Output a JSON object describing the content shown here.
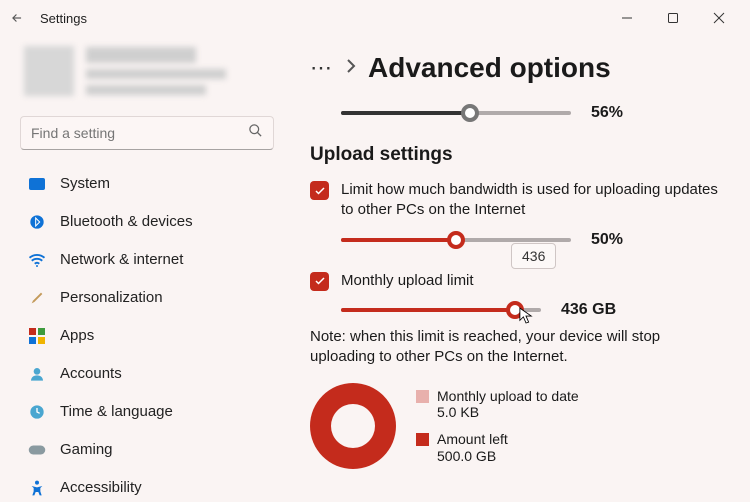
{
  "titlebar": {
    "title": "Settings"
  },
  "search": {
    "placeholder": "Find a setting"
  },
  "nav": [
    {
      "id": "system",
      "label": "System",
      "color": "#0f72d6"
    },
    {
      "id": "bluetooth",
      "label": "Bluetooth & devices",
      "color": "#0f72d6"
    },
    {
      "id": "network",
      "label": "Network & internet",
      "color": "#0f72d6"
    },
    {
      "id": "personalization",
      "label": "Personalization",
      "color": "#c49a5a"
    },
    {
      "id": "apps",
      "label": "Apps",
      "color": "#c42b1c"
    },
    {
      "id": "accounts",
      "label": "Accounts",
      "color": "#4aa6d0"
    },
    {
      "id": "time",
      "label": "Time & language",
      "color": "#4aa6d0"
    },
    {
      "id": "gaming",
      "label": "Gaming",
      "color": "#8a9aa0"
    },
    {
      "id": "accessibility",
      "label": "Accessibility",
      "color": "#0f72d6"
    }
  ],
  "header": {
    "title": "Advanced options"
  },
  "topSlider": {
    "percent": 56,
    "label": "56%"
  },
  "section": {
    "title": "Upload settings"
  },
  "opt1": {
    "text": "Limit how much bandwidth is used for uploading updates to other PCs on the Internet",
    "percent": 50,
    "label": "50%",
    "tooltip": "436"
  },
  "opt2": {
    "text": "Monthly upload limit",
    "percent": 87,
    "label": "436 GB"
  },
  "note": "Note: when this limit is reached, your device will stop uploading to other PCs on the Internet.",
  "legend": {
    "a_label": "Monthly upload to date",
    "a_value": "5.0 KB",
    "b_label": "Amount left",
    "b_value": "500.0 GB"
  }
}
